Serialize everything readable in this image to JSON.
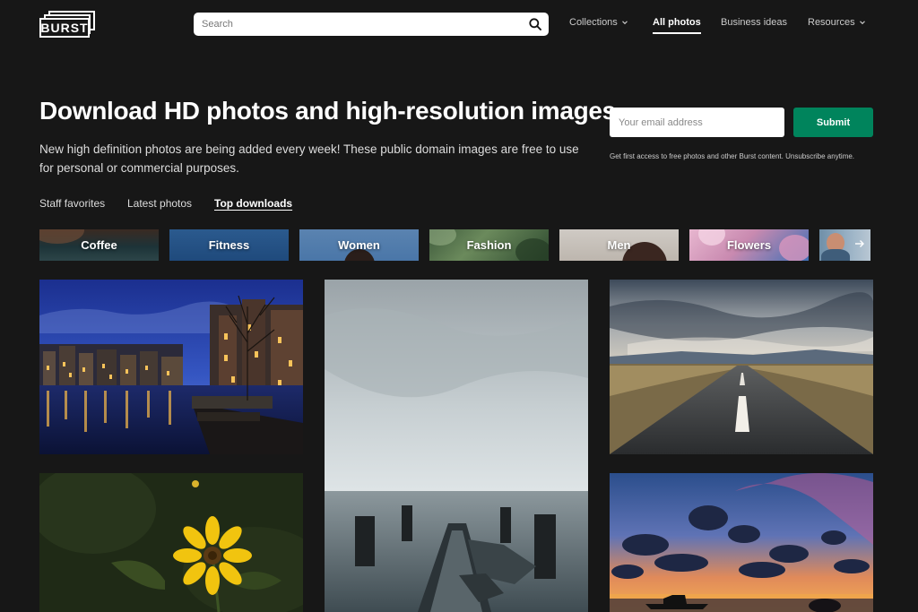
{
  "brand": {
    "logo_text": "BURST"
  },
  "search": {
    "placeholder": "Search"
  },
  "nav": [
    {
      "label": "Collections",
      "dropdown": true,
      "active": false
    },
    {
      "label": "All photos",
      "dropdown": false,
      "active": true
    },
    {
      "label": "Business ideas",
      "dropdown": false,
      "active": false
    },
    {
      "label": "Resources",
      "dropdown": true,
      "active": false
    }
  ],
  "hero": {
    "title": "Download HD photos and high-resolution images",
    "subtitle": "New high definition photos are being added every week! These public domain images are free to use for personal or commercial purposes."
  },
  "newsletter": {
    "email_placeholder": "Your email address",
    "submit_label": "Submit",
    "disclaimer": "Get first access to free photos and other Burst content. Unsubscribe anytime."
  },
  "tabs": [
    {
      "label": "Staff favorites",
      "active": false
    },
    {
      "label": "Latest photos",
      "active": false
    },
    {
      "label": "Top downloads",
      "active": true
    }
  ],
  "categories": [
    {
      "label": "Coffee"
    },
    {
      "label": "Fitness"
    },
    {
      "label": "Women"
    },
    {
      "label": "Fashion"
    },
    {
      "label": "Men"
    },
    {
      "label": "Flowers"
    }
  ],
  "colors": {
    "background": "#171717",
    "accent_green": "#00845c",
    "text": "#ffffff"
  },
  "icons": {
    "search": "search-icon",
    "dropdown": "chevron-down-icon",
    "next": "arrow-right-icon"
  },
  "photos": [
    {
      "subject": "city-canal-at-night"
    },
    {
      "subject": "pier-posts-in-calm-sea"
    },
    {
      "subject": "open-road-landscape"
    },
    {
      "subject": "yellow-flower"
    },
    {
      "subject": "sunset-clouds-over-water"
    }
  ]
}
